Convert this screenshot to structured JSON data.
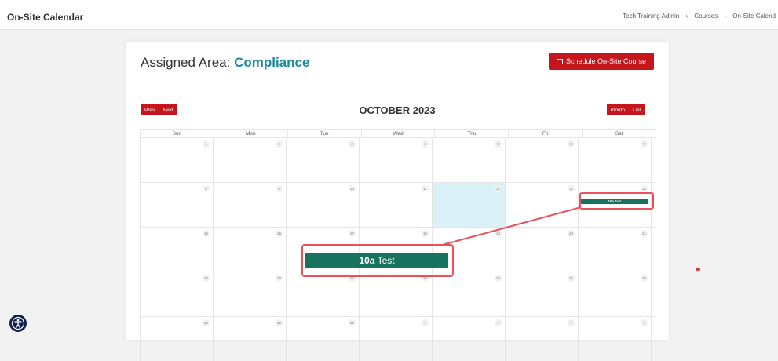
{
  "page": {
    "title": "On-Site Calendar"
  },
  "breadcrumb": [
    "Tech Training Admin",
    "Courses",
    "On-Site Calend"
  ],
  "breadcrumb_sep": "›",
  "assigned_area": {
    "label": "Assigned Area:",
    "value": "Compliance"
  },
  "schedule_button": "Schedule On-Site Course",
  "nav": {
    "prev": "Prev",
    "next": "Next"
  },
  "view": {
    "month": "month",
    "list": "List"
  },
  "month_title": "OCTOBER 2023",
  "weekdays": [
    "Sun",
    "Mon",
    "Tue",
    "Wed",
    "Thu",
    "Fri",
    "Sat"
  ],
  "weeks": [
    [
      "1",
      "2",
      "3",
      "4",
      "5",
      "6",
      "7"
    ],
    [
      "8",
      "9",
      "10",
      "11",
      "12",
      "13",
      "14"
    ],
    [
      "15",
      "16",
      "17",
      "18",
      "19",
      "20",
      "21"
    ],
    [
      "22",
      "23",
      "24",
      "25",
      "26",
      "27",
      "28"
    ],
    [
      "29",
      "30",
      "31",
      "1",
      "2",
      "3",
      "4"
    ]
  ],
  "today": "12",
  "event": {
    "time": "10a",
    "title": "Test",
    "date": "14"
  },
  "colors": {
    "accent_red": "#c4161c",
    "event_green": "#17735e",
    "area_teal": "#1a8a9c",
    "highlight": "#e8535a"
  }
}
